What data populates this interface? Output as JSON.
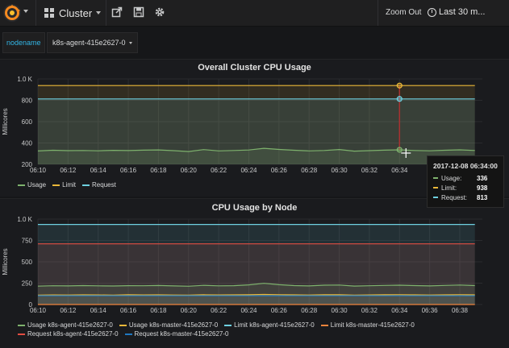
{
  "colors": {
    "usage": "#7eb26d",
    "limit": "#eab839",
    "request": "#6ed0e0",
    "limit_master": "#ef843c",
    "request_agent": "#e24d42",
    "request_master": "#1f78c1",
    "accent": "#33b5e5"
  },
  "topbar": {
    "dashboard_title": "Cluster",
    "zoom_out_label": "Zoom Out",
    "time_range_label": "Last 30 m...",
    "icons": [
      "grafana-logo-icon",
      "share-icon",
      "save-icon",
      "gear-icon",
      "clock-icon"
    ]
  },
  "variables": {
    "label": "nodename",
    "value": "k8s-agent-415e2627-0"
  },
  "panels": [
    {
      "title": "Overall Cluster CPU Usage",
      "ylabel": "Millicores"
    },
    {
      "title": "CPU Usage by Node",
      "ylabel": "Millicores"
    }
  ],
  "tooltip": {
    "time": "2017-12-08 06:34:00",
    "rows": [
      {
        "name": "Usage:",
        "value": "336"
      },
      {
        "name": "Limit:",
        "value": "938"
      },
      {
        "name": "Request:",
        "value": "813"
      }
    ]
  },
  "chart_data": [
    {
      "type": "line",
      "title": "Overall Cluster CPU Usage",
      "ylabel": "Millicores",
      "xlabel": "",
      "ylim": [
        200,
        1000
      ],
      "ytick_labels": [
        "200",
        "400",
        "600",
        "800",
        "1.0 K"
      ],
      "ytick_values": [
        200,
        400,
        600,
        800,
        1000
      ],
      "xtick_labels": [
        "06:10",
        "06:12",
        "06:14",
        "06:16",
        "06:18",
        "06:20",
        "06:22",
        "06:24",
        "06:26",
        "06:28",
        "06:30",
        "06:32",
        "06:34"
      ],
      "x": [
        "06:10",
        "06:11",
        "06:12",
        "06:13",
        "06:14",
        "06:15",
        "06:16",
        "06:17",
        "06:18",
        "06:19",
        "06:20",
        "06:21",
        "06:22",
        "06:23",
        "06:24",
        "06:25",
        "06:26",
        "06:27",
        "06:28",
        "06:29",
        "06:30",
        "06:31",
        "06:32",
        "06:33",
        "06:34",
        "06:35",
        "06:36",
        "06:37",
        "06:38",
        "06:39"
      ],
      "series": [
        {
          "name": "Usage",
          "values": [
            325,
            332,
            328,
            330,
            327,
            331,
            329,
            333,
            335,
            328,
            320,
            338,
            326,
            330,
            334,
            350,
            340,
            332,
            326,
            330,
            339,
            324,
            328,
            333,
            336,
            330,
            327,
            332,
            336,
            330
          ]
        },
        {
          "name": "Limit",
          "values": [
            938,
            938,
            938,
            938,
            938,
            938,
            938,
            938,
            938,
            938,
            938,
            938,
            938,
            938,
            938,
            938,
            938,
            938,
            938,
            938,
            938,
            938,
            938,
            938,
            938,
            938,
            938,
            938,
            938,
            938
          ]
        },
        {
          "name": "Request",
          "values": [
            813,
            813,
            813,
            813,
            813,
            813,
            813,
            813,
            813,
            813,
            813,
            813,
            813,
            813,
            813,
            813,
            813,
            813,
            813,
            813,
            813,
            813,
            813,
            813,
            813,
            813,
            813,
            813,
            813,
            813
          ]
        }
      ],
      "grid": true,
      "legend": "bottom-left"
    },
    {
      "type": "line",
      "title": "CPU Usage by Node",
      "ylabel": "Millicores",
      "xlabel": "",
      "ylim": [
        0,
        1000
      ],
      "ytick_labels": [
        "0",
        "250",
        "500",
        "750",
        "1.0 K"
      ],
      "ytick_values": [
        0,
        250,
        500,
        750,
        1000
      ],
      "xtick_labels": [
        "06:10",
        "06:12",
        "06:14",
        "06:16",
        "06:18",
        "06:20",
        "06:22",
        "06:24",
        "06:26",
        "06:28",
        "06:30",
        "06:32",
        "06:34",
        "06:36",
        "06:38"
      ],
      "x": [
        "06:10",
        "06:11",
        "06:12",
        "06:13",
        "06:14",
        "06:15",
        "06:16",
        "06:17",
        "06:18",
        "06:19",
        "06:20",
        "06:21",
        "06:22",
        "06:23",
        "06:24",
        "06:25",
        "06:26",
        "06:27",
        "06:28",
        "06:29",
        "06:30",
        "06:31",
        "06:32",
        "06:33",
        "06:34",
        "06:35",
        "06:36",
        "06:37",
        "06:38",
        "06:39"
      ],
      "series": [
        {
          "name": "Usage k8s-agent-415e2627-0",
          "values": [
            215,
            220,
            218,
            222,
            219,
            217,
            221,
            220,
            223,
            218,
            214,
            225,
            219,
            221,
            230,
            248,
            232,
            222,
            218,
            226,
            228,
            216,
            220,
            224,
            226,
            222,
            218,
            224,
            228,
            222
          ]
        },
        {
          "name": "Usage k8s-master-415e2627-0",
          "values": [
            110,
            112,
            111,
            113,
            112,
            110,
            114,
            112,
            113,
            111,
            109,
            114,
            112,
            113,
            114,
            118,
            115,
            113,
            111,
            114,
            115,
            110,
            112,
            114,
            115,
            113,
            111,
            113,
            115,
            113
          ]
        },
        {
          "name": "Limit k8s-agent-415e2627-0",
          "values": [
            938,
            938,
            938,
            938,
            938,
            938,
            938,
            938,
            938,
            938,
            938,
            938,
            938,
            938,
            938,
            938,
            938,
            938,
            938,
            938,
            938,
            938,
            938,
            938,
            938,
            938,
            938,
            938,
            938,
            938
          ]
        },
        {
          "name": "Limit k8s-master-415e2627-0",
          "values": [
            0,
            0,
            0,
            0,
            0,
            0,
            0,
            0,
            0,
            0,
            0,
            0,
            0,
            0,
            0,
            0,
            0,
            0,
            0,
            0,
            0,
            0,
            0,
            0,
            0,
            0,
            0,
            0,
            0,
            0
          ]
        },
        {
          "name": "Request k8s-agent-415e2627-0",
          "values": [
            710,
            710,
            710,
            710,
            710,
            710,
            710,
            710,
            710,
            710,
            710,
            710,
            710,
            710,
            710,
            710,
            710,
            710,
            710,
            710,
            710,
            710,
            710,
            710,
            710,
            710,
            710,
            710,
            710,
            710
          ]
        },
        {
          "name": "Request k8s-master-415e2627-0",
          "values": [
            103,
            103,
            103,
            103,
            103,
            103,
            103,
            103,
            103,
            103,
            103,
            103,
            103,
            103,
            103,
            103,
            103,
            103,
            103,
            103,
            103,
            103,
            103,
            103,
            103,
            103,
            103,
            103,
            103,
            103
          ]
        }
      ],
      "grid": true,
      "legend": "bottom-left"
    }
  ]
}
